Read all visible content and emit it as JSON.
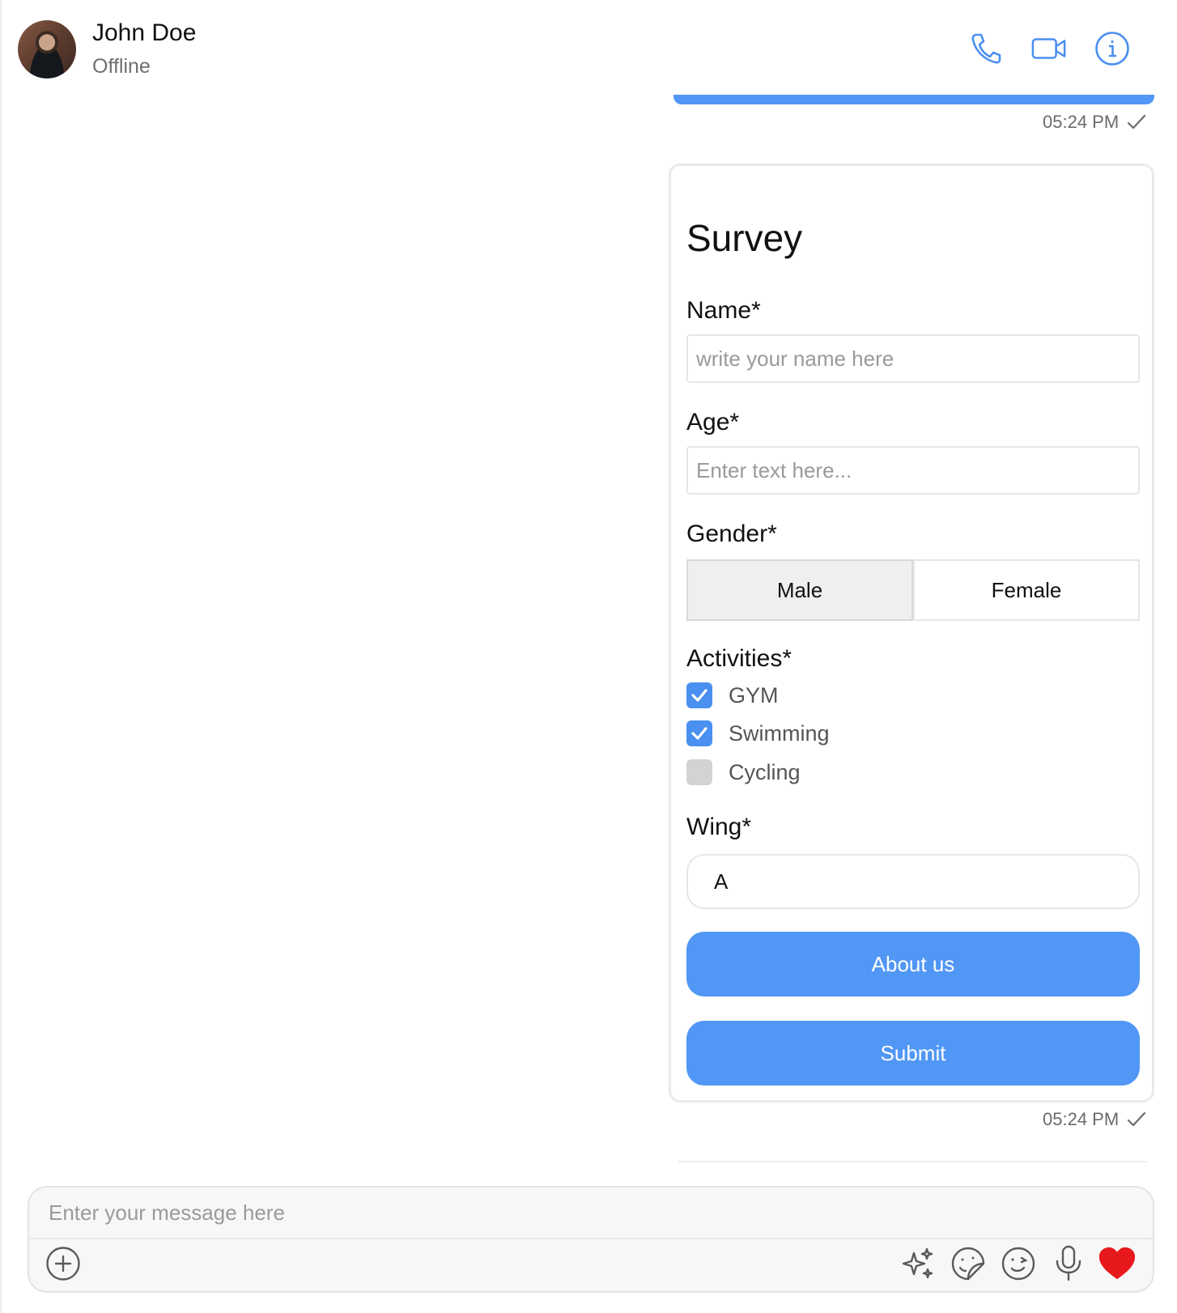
{
  "header": {
    "contact_name": "John Doe",
    "contact_status": "Offline",
    "icons": [
      "phone-icon",
      "video-icon",
      "info-icon"
    ]
  },
  "messages": {
    "previous_timestamp": "05:24 PM",
    "survey_timestamp": "05:24 PM"
  },
  "survey": {
    "title": "Survey",
    "name_label": "Name*",
    "name_placeholder": "write your name here",
    "name_value": "",
    "age_label": "Age*",
    "age_placeholder": "Enter text here...",
    "age_value": "",
    "gender_label": "Gender*",
    "gender_options": [
      "Male",
      "Female"
    ],
    "gender_selected": "Male",
    "activities_label": "Activities*",
    "activities": [
      {
        "label": "GYM",
        "checked": true
      },
      {
        "label": "Swimming",
        "checked": true
      },
      {
        "label": "Cycling",
        "checked": false
      }
    ],
    "wing_label": "Wing*",
    "wing_selected": "A",
    "about_button": "About us",
    "submit_button": "Submit"
  },
  "composer": {
    "placeholder": "Enter your message here",
    "icons": [
      "add-icon",
      "sparkle-icon",
      "sticker-icon",
      "emoji-icon",
      "microphone-icon",
      "heart-icon"
    ]
  },
  "colors": {
    "accent": "#5197f5",
    "checkbox_checked": "#4a90f0",
    "heart": "#e8191c"
  }
}
